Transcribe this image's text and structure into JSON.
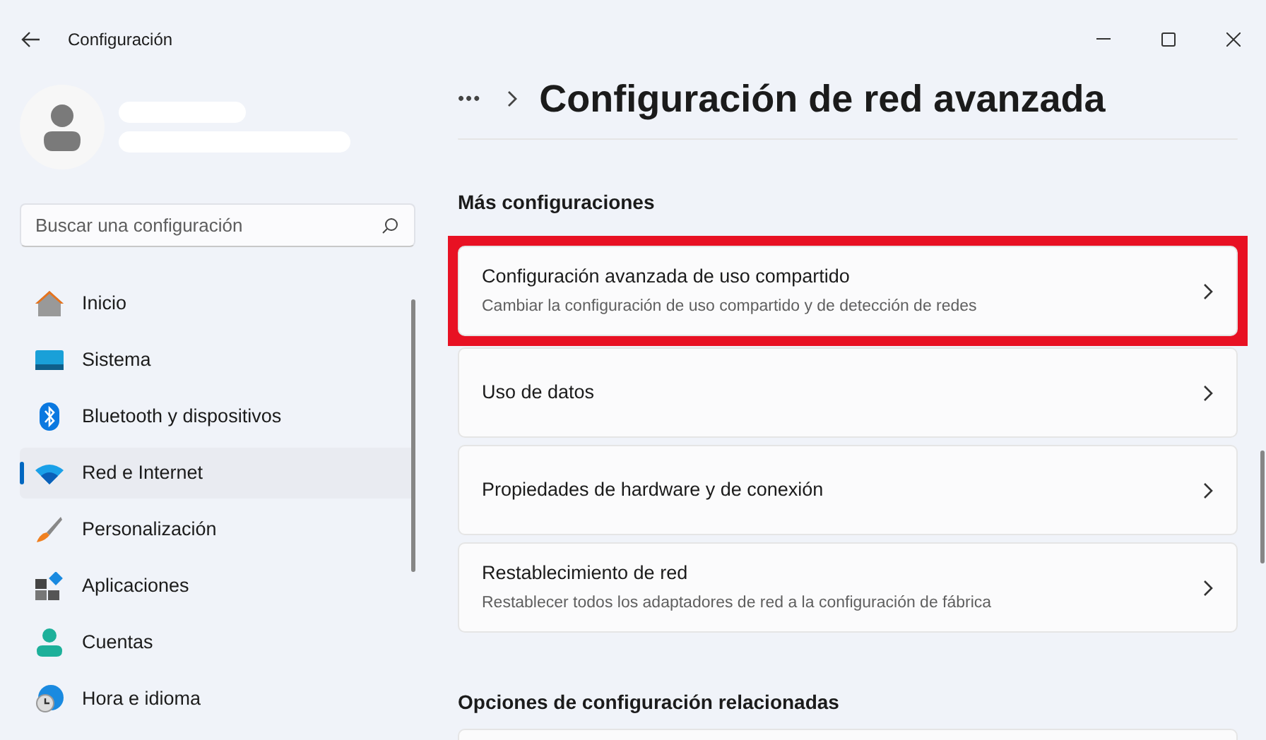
{
  "window": {
    "title": "Configuración"
  },
  "search": {
    "placeholder": "Buscar una configuración"
  },
  "sidebar": {
    "items": [
      {
        "label": "Inicio",
        "selected": false
      },
      {
        "label": "Sistema",
        "selected": false
      },
      {
        "label": "Bluetooth y dispositivos",
        "selected": false
      },
      {
        "label": "Red e Internet",
        "selected": true
      },
      {
        "label": "Personalización",
        "selected": false
      },
      {
        "label": "Aplicaciones",
        "selected": false
      },
      {
        "label": "Cuentas",
        "selected": false
      },
      {
        "label": "Hora e idioma",
        "selected": false
      }
    ]
  },
  "breadcrumb": {
    "ellipsis": "•••",
    "title": "Configuración de red avanzada"
  },
  "sections": [
    {
      "heading": "Más configuraciones",
      "items": [
        {
          "title": "Configuración avanzada de uso compartido",
          "description": "Cambiar la configuración de uso compartido y de detección de redes",
          "highlighted": true
        },
        {
          "title": "Uso de datos",
          "highlighted": false
        },
        {
          "title": "Propiedades de hardware y de conexión",
          "highlighted": false
        },
        {
          "title": "Restablecimiento de red",
          "description": "Restablecer todos los adaptadores de red a la configuración de fábrica",
          "highlighted": false
        }
      ]
    },
    {
      "heading": "Opciones de configuración relacionadas"
    }
  ]
}
